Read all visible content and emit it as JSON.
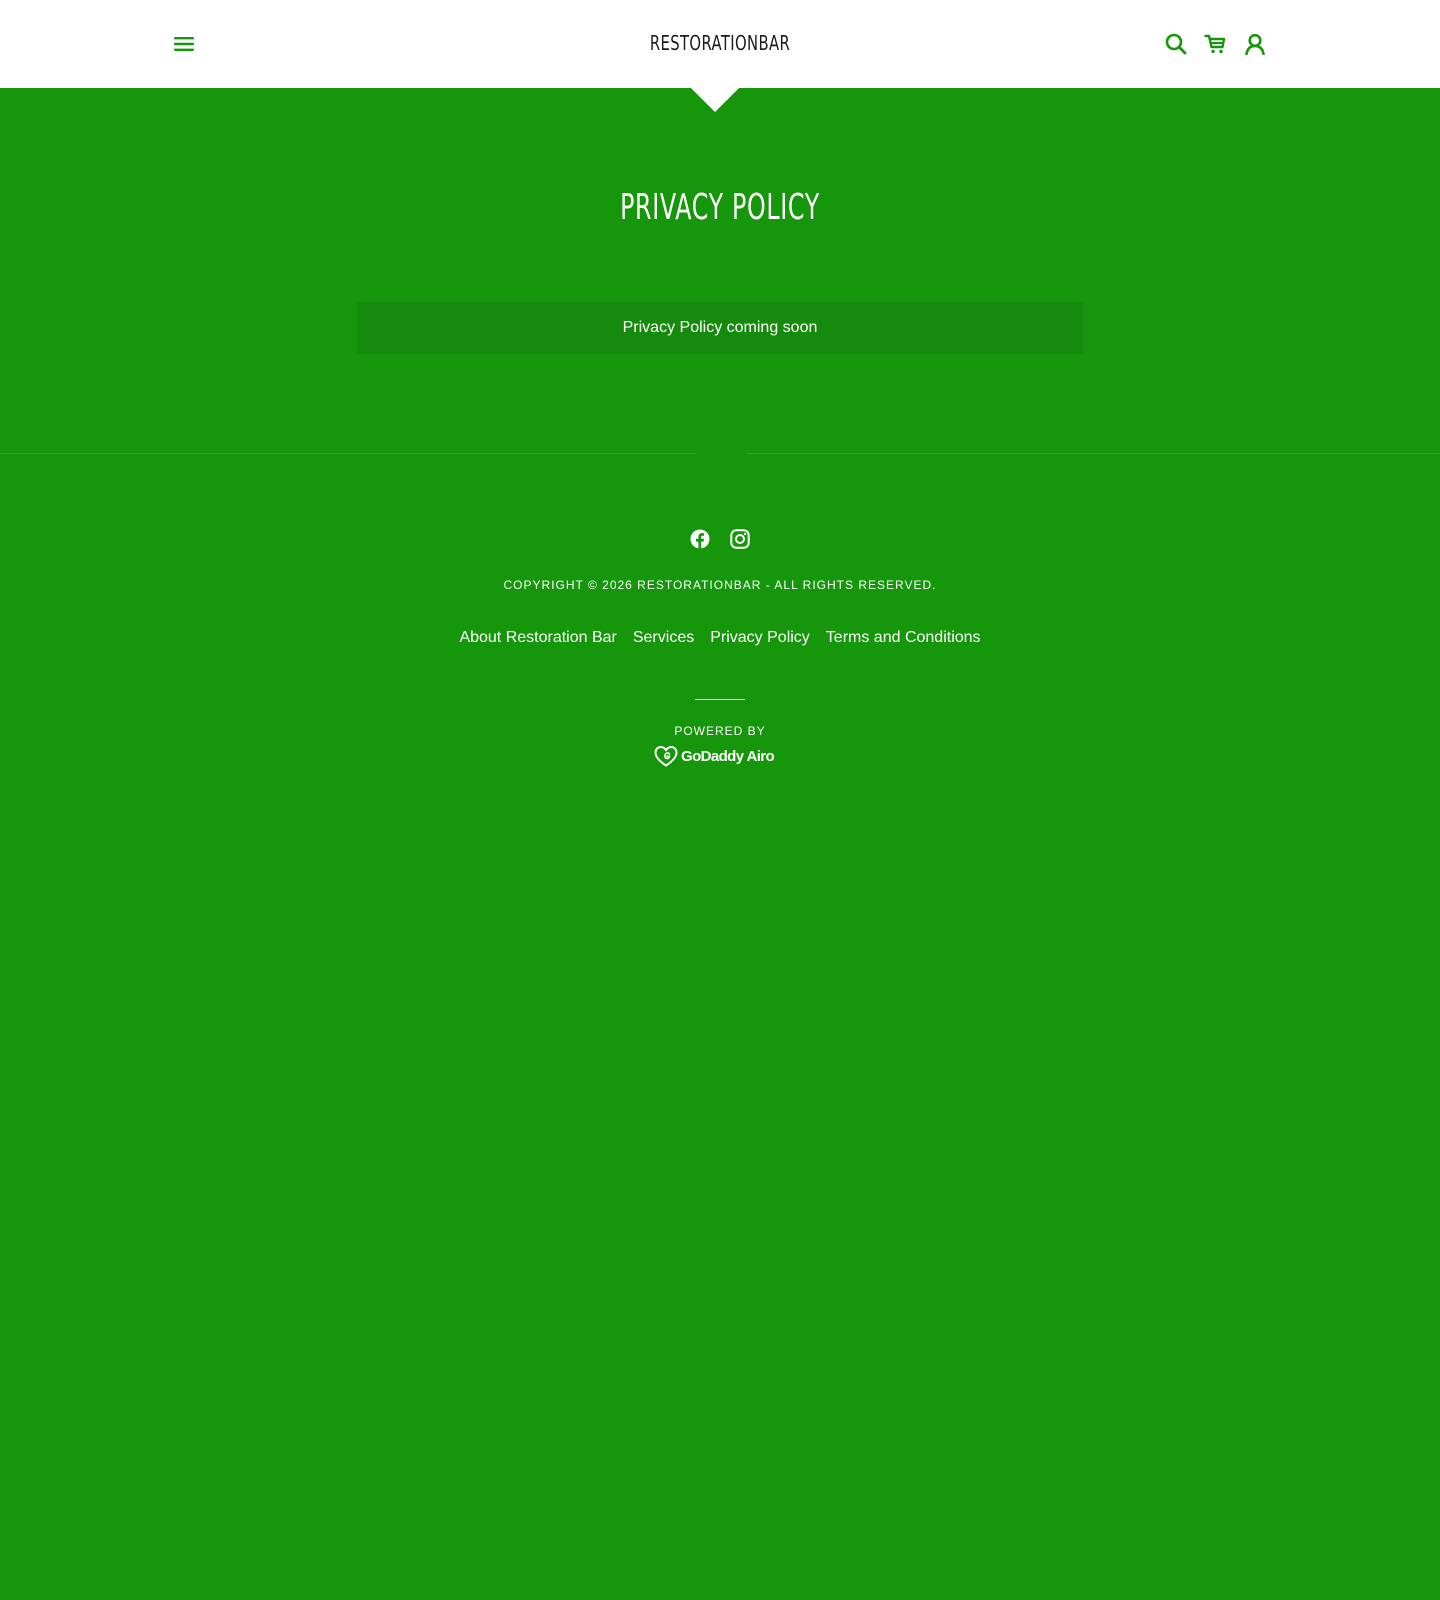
{
  "colors": {
    "background": "#16970b",
    "header_bg": "#ffffff",
    "accent": "#16970b",
    "notice_bg": "#158a0d",
    "text": "#ffffff",
    "title_dark": "#1b1b1b"
  },
  "header": {
    "site_title": "RESTORATIONBAR",
    "icons": {
      "menu": "hamburger-menu-icon",
      "search": "search-icon",
      "cart": "shopping-cart-icon",
      "account": "user-account-icon"
    }
  },
  "main": {
    "page_title": "PRIVACY POLICY",
    "notice_text": "Privacy Policy coming soon"
  },
  "footer": {
    "social": [
      "facebook-icon",
      "instagram-icon"
    ],
    "copyright": "COPYRIGHT © 2026 RESTORATIONBAR - ALL RIGHTS RESERVED.",
    "nav": [
      {
        "label": "About Restoration Bar"
      },
      {
        "label": "Services"
      },
      {
        "label": "Privacy Policy"
      },
      {
        "label": "Terms and Conditions"
      }
    ],
    "powered_by": "POWERED BY",
    "brand": "GoDaddy Airo"
  }
}
